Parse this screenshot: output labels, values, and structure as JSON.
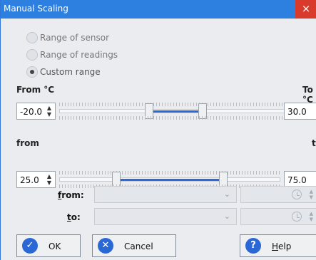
{
  "window": {
    "title": "Manual Scaling",
    "close_label": "×"
  },
  "scaling_options": [
    {
      "label": "Range of sensor",
      "checked": false
    },
    {
      "label": "Range of readings",
      "checked": false
    },
    {
      "label": "Custom range",
      "checked": true
    }
  ],
  "temperature_range": {
    "from_label": "From °C",
    "to_label": "To °C",
    "from_value": "-20.0",
    "to_value": "30.0"
  },
  "readings_range": {
    "from_label": "from",
    "to_label": "to",
    "from_value": "25.0",
    "to_value": "75.0"
  },
  "time_range": {
    "from_label": "from:",
    "to_label": "to:",
    "from_value": "",
    "to_value": ""
  },
  "buttons": {
    "ok_label": "OK",
    "cancel_label": "Cancel",
    "help_label": "Help"
  },
  "colors": {
    "titlebar": "#2d7fe0",
    "close": "#d83a2b",
    "accent": "#2a6ad7"
  },
  "icons": {
    "ok_icon": "check-circle-icon",
    "cancel_icon": "x-circle-icon",
    "help_icon": "question-icon"
  }
}
